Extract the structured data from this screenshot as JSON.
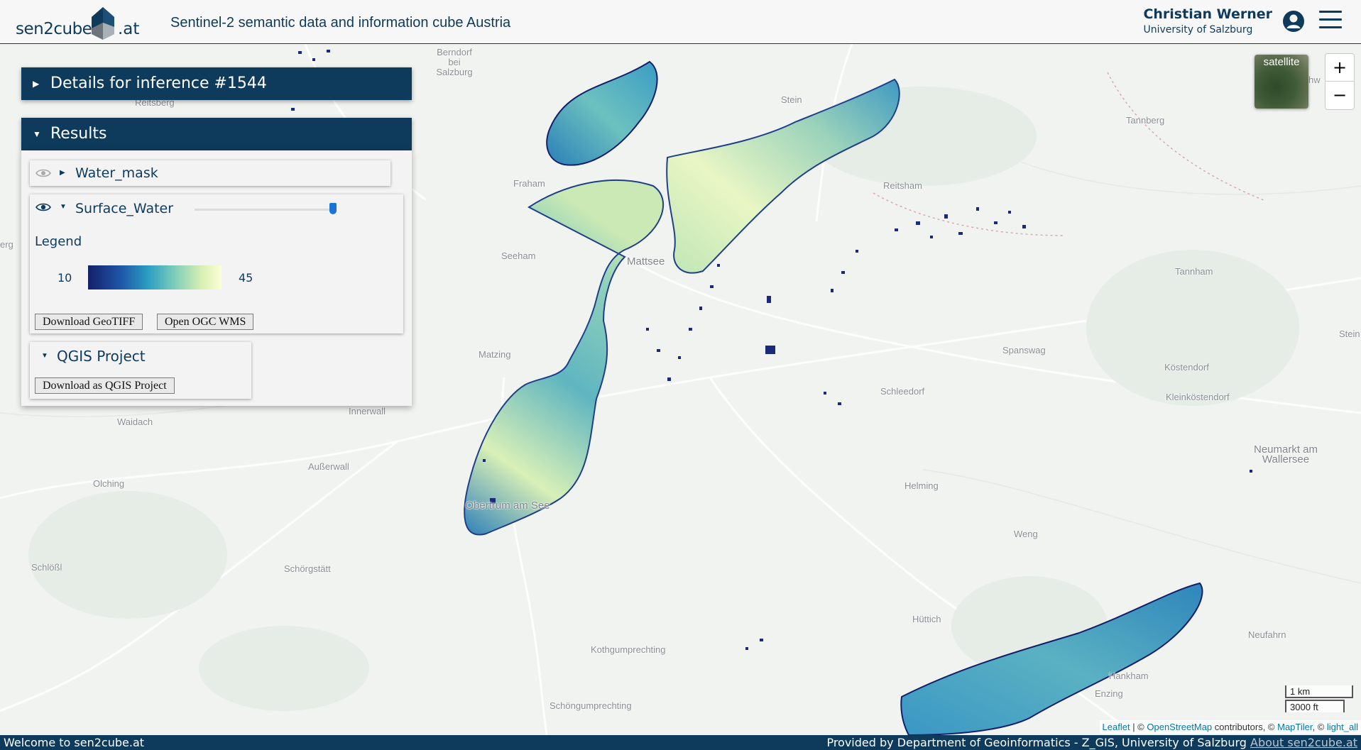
{
  "header": {
    "logo_text": "sen2cube",
    "logo_tld": ".at",
    "title": "Sentinel-2 semantic data and information cube Austria",
    "user_name": "Christian Werner",
    "user_org": "University of Salzburg"
  },
  "panel": {
    "details_title": "Details for inference #1544",
    "results_title": "Results",
    "layers": [
      {
        "name": "Water_mask",
        "expanded": false,
        "visible": false
      },
      {
        "name": "Surface_Water",
        "expanded": true,
        "visible": true,
        "opacity": 1.0
      }
    ],
    "legend": {
      "label": "Legend",
      "min": "10",
      "max": "45",
      "colors": [
        "#141f6b",
        "#1f58a8",
        "#2b9ec2",
        "#7ecdb9",
        "#d7efb3",
        "#fdfed5"
      ]
    },
    "buttons": {
      "download_geotiff": "Download GeoTIFF",
      "open_wms": "Open OGC WMS"
    },
    "qgis": {
      "title": "QGIS Project",
      "download": "Download as QGIS Project"
    }
  },
  "map": {
    "basemap_toggle": "satellite",
    "zoom_in": "+",
    "zoom_out": "−",
    "scale_metric": "1 km",
    "scale_imperial": "3000 ft",
    "places": [
      "Berndorf bei Salzburg",
      "Reitsberg",
      "Stein",
      "Tannberg",
      "Fraham",
      "Reitsham",
      "Mattsee",
      "Seeham",
      "Tannham",
      "erg",
      "Matzing",
      "Spanswag",
      "Köstendorf",
      "Schleedorf",
      "Kleinköstendorf",
      "Innerwall",
      "Waidach",
      "Außerwall",
      "Olching",
      "Obertrum am See",
      "Helming",
      "Neumarkt am Wallersee",
      "Weng",
      "Schlößl",
      "Schörgstätt",
      "Hüttich",
      "Neufahrn",
      "Kothgumprechting",
      "Hankham",
      "Enzing",
      "Schöngumprechting",
      "Stein",
      "hw"
    ],
    "attribution": {
      "leaflet": "Leaflet",
      "sep1": " | © ",
      "osm": "OpenStreetMap",
      "contrib": " contributors, © ",
      "maptiler": "MapTiler",
      "sep2": ", © ",
      "light": "light_all"
    },
    "colors": {
      "water_dark": "#141f6b",
      "water_mid": "#2b9ec2",
      "water_light": "#fdfed5"
    }
  },
  "footer": {
    "welcome": "Welcome to sen2cube.at",
    "provided": "Provided by Department of Geoinformatics - Z_GIS, University of Salzburg",
    "about": "About sen2cube.at"
  }
}
